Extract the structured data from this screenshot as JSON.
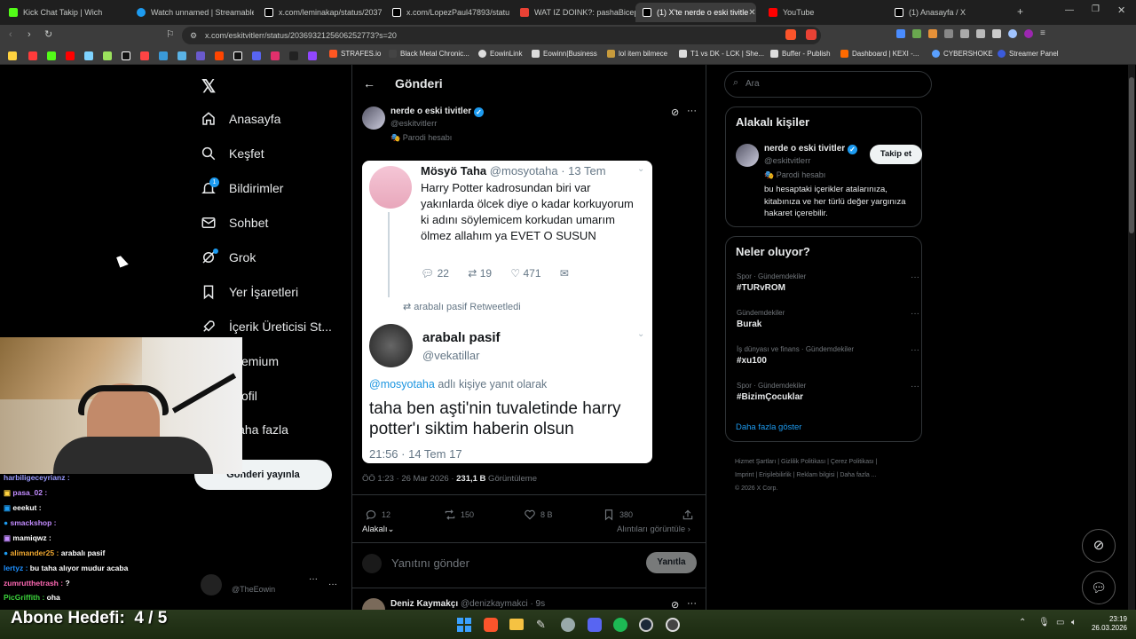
{
  "browser": {
    "tabs": [
      {
        "label": "Kick Chat Takip | Wich",
        "color": "#53fc18"
      },
      {
        "label": "Watch unnamed | Streamable",
        "color": "#1d9bf0"
      },
      {
        "label": "x.com/leminakap/status/20371",
        "color": "#ffffff"
      },
      {
        "label": "x.com/LopezPaul47893/status/",
        "color": "#ffffff"
      },
      {
        "label": "WAT IZ DOINK?: pashaBiceps",
        "color": "#e94235"
      },
      {
        "label": "(1) X'te nerde o eski tivitle",
        "color": "#ffffff"
      },
      {
        "label": "YouTube",
        "color": "#ff0000"
      },
      {
        "label": "(1) Anasayfa / X",
        "color": "#ffffff"
      }
    ],
    "url": "x.com/eskitvitlerr/status/2036932125606252773?s=20",
    "bookmarks": [
      "STRAFES.io",
      "Black Metal Chronic...",
      "EowinLink",
      "Eowinn|Business",
      "lol item bilmece",
      "T1 vs DK - LCK | She...",
      "Buffer - Publish",
      "Dashboard | KEXI -...",
      "CYBERSHOKE",
      "Streamer Panel"
    ]
  },
  "nav": {
    "items": [
      "Anasayfa",
      "Keşfet",
      "Bildirimler",
      "Sohbet",
      "Grok",
      "Yer İşaretleri",
      "İçerik Üreticisi St...",
      "Premium",
      "Profil",
      "Daha fazla"
    ],
    "notif_count": "1",
    "post_button": "Gönderi yayınla",
    "account_handle": "@TheEowin"
  },
  "main": {
    "header_title": "Gönderi",
    "author_name": "nerde o eski tivitler",
    "author_handle": "@eskitvitlerr",
    "parody_label": "Parodi hesabı",
    "image": {
      "tweet1_name": "Mösyö Taha",
      "tweet1_handle": "@mosyotaha · 13 Tem",
      "tweet1_text": "Harry Potter kadrosundan biri var yakınlarda ölcek diye o kadar korkuyorum ki adını söylemicem korkudan umarım ölmez allahım ya EVET O SUSUN",
      "tweet1_replies": "22",
      "tweet1_rts": "19",
      "tweet1_likes": "471",
      "retweeted_by": "arabalı pasif Retweetledi",
      "tweet2_name": "arabalı pasif",
      "tweet2_handle": "@vekatillar",
      "reply_to_handle": "@mosyotaha",
      "reply_to_suffix": " adlı kişiye yanıt olarak",
      "tweet2_text": "taha ben aşti'nin tuvaletinde harry potter'ı siktim haberin olsun",
      "tweet2_time": "21:56 · 14 Tem 17"
    },
    "timestamp": "ÖÖ 1:23 · 26 Mar 2026 · ",
    "views_count": "231,1 B",
    "views_label": " Görüntüleme",
    "replies": "12",
    "reposts": "150",
    "likes": "8 B",
    "bookmarks": "380",
    "relevant_label": "Alakalı",
    "quotes_label": "Alıntıları görüntüle",
    "reply_placeholder": "Yanıtını gönder",
    "reply_button": "Yanıtla",
    "next_reply_name": "Deniz Kaymakçı",
    "next_reply_handle": "@denizkaymakci · 9s"
  },
  "right": {
    "search_placeholder": "Ara",
    "relevant_title": "Alakalı kişiler",
    "person_name": "nerde o eski tivitler",
    "person_handle": "@eskitvitlerr",
    "person_parody": "Parodi hesabı",
    "person_bio": "bu hesaptaki içerikler atalarınıza, kitabınıza ve her türlü değer yargınıza hakaret içerebilir.",
    "follow_button": "Takip et",
    "trends_title": "Neler oluyor?",
    "trends": [
      {
        "category": "Spor · Gündemdekiler",
        "name": "#TURvROM"
      },
      {
        "category": "Gündemdekiler",
        "name": "Burak"
      },
      {
        "category": "İş dünyası ve finans · Gündemdekiler",
        "name": "#xu100"
      },
      {
        "category": "Spor · Gündemdekiler",
        "name": "#BizimÇocuklar"
      }
    ],
    "show_more": "Daha fazla göster",
    "footer_links": [
      "Hizmet Şartları",
      "Gizlilik Politikası",
      "Çerez Politikası",
      "Imprint",
      "Erişilebilirlik",
      "Reklam bilgisi",
      "Daha fazla ..."
    ],
    "copyright": "© 2026 X Corp."
  },
  "stream": {
    "chat": [
      {
        "user": "harbiligeceyrianz",
        "msg": "",
        "color": "#9a9aff"
      },
      {
        "user": "pasa_02",
        "msg": "",
        "color": "#c38cff"
      },
      {
        "user": "eeekut",
        "msg": "",
        "color": "#ffffff"
      },
      {
        "user": "smackshop",
        "msg": "",
        "color": "#c38cff"
      },
      {
        "user": "mamiqwz",
        "msg": "",
        "color": "#ffffff"
      },
      {
        "user": "alimander25",
        "msg": "arabalı pasif",
        "color": "#f0a830"
      },
      {
        "user": "lertyz",
        "msg": "bu taha alıyor mudur acaba",
        "color": "#1e90ff"
      },
      {
        "user": "zumrutthetrash",
        "msg": "?",
        "color": "#ff69b4"
      },
      {
        "user": "PicGriffith",
        "msg": "oha",
        "color": "#3cd53c"
      }
    ],
    "goal": "Abone Hedefi:  4 / 5"
  },
  "taskbar": {
    "time": "23:19",
    "date": "26.03.2026"
  }
}
